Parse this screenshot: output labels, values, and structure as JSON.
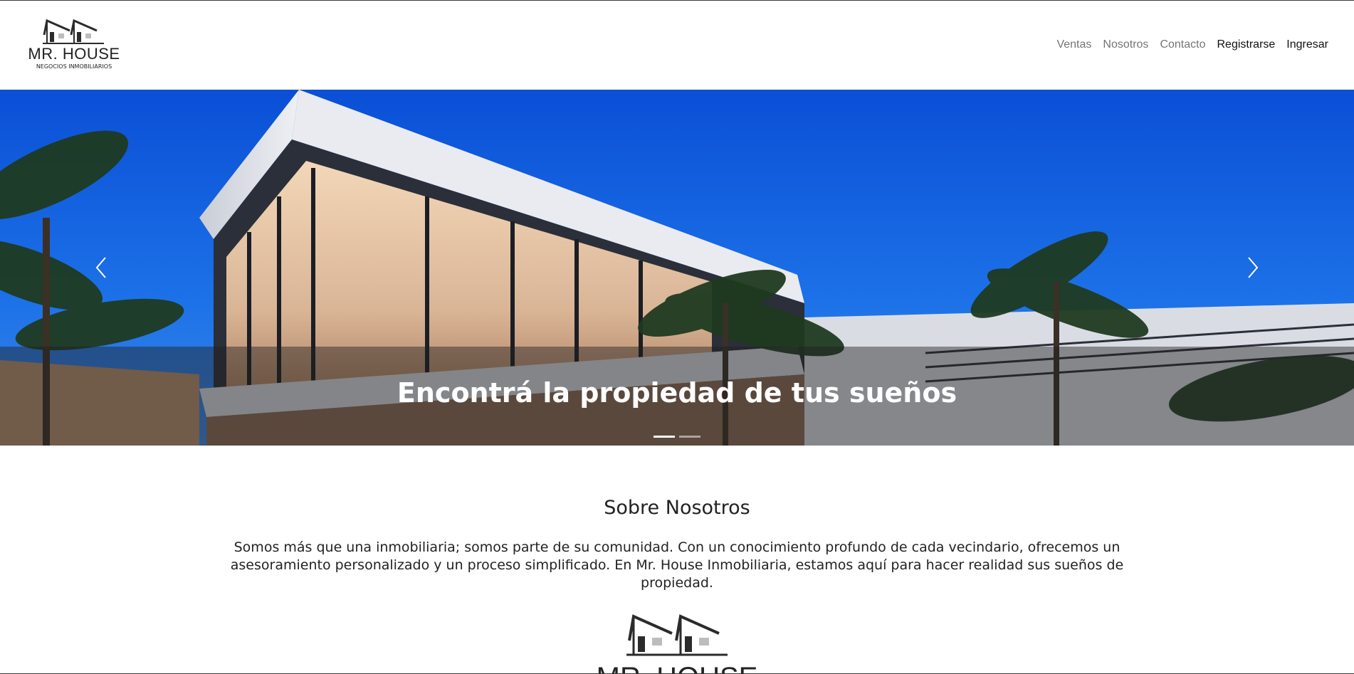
{
  "brand": {
    "name": "MR. HOUSE",
    "tagline": "NEGOCIOS INMOBILIARIOS"
  },
  "nav": {
    "items": [
      {
        "label": "Ventas"
      },
      {
        "label": "Nosotros"
      },
      {
        "label": "Contacto"
      },
      {
        "label": "Registrarse"
      },
      {
        "label": "Ingresar"
      }
    ]
  },
  "carousel": {
    "caption": "Encontrá la propiedad de tus sueños",
    "prev_icon": "chevron-left-icon",
    "next_icon": "chevron-right-icon",
    "slide_count": 2,
    "active_slide": 1
  },
  "about": {
    "title": "Sobre Nosotros",
    "text": "Somos más que una inmobiliaria; somos parte de su comunidad. Con un conocimiento profundo de cada vecindario, ofrecemos un asesoramiento personalizado y un proceso simplificado. En Mr. House Inmobiliaria, estamos aquí para hacer realidad sus sueños de propiedad.",
    "logo_name": "MR. HOUSE"
  },
  "colors": {
    "sky": "#0b56d8",
    "nav_text": "#737373",
    "nav_text_strong": "#111111",
    "text": "#222222"
  }
}
